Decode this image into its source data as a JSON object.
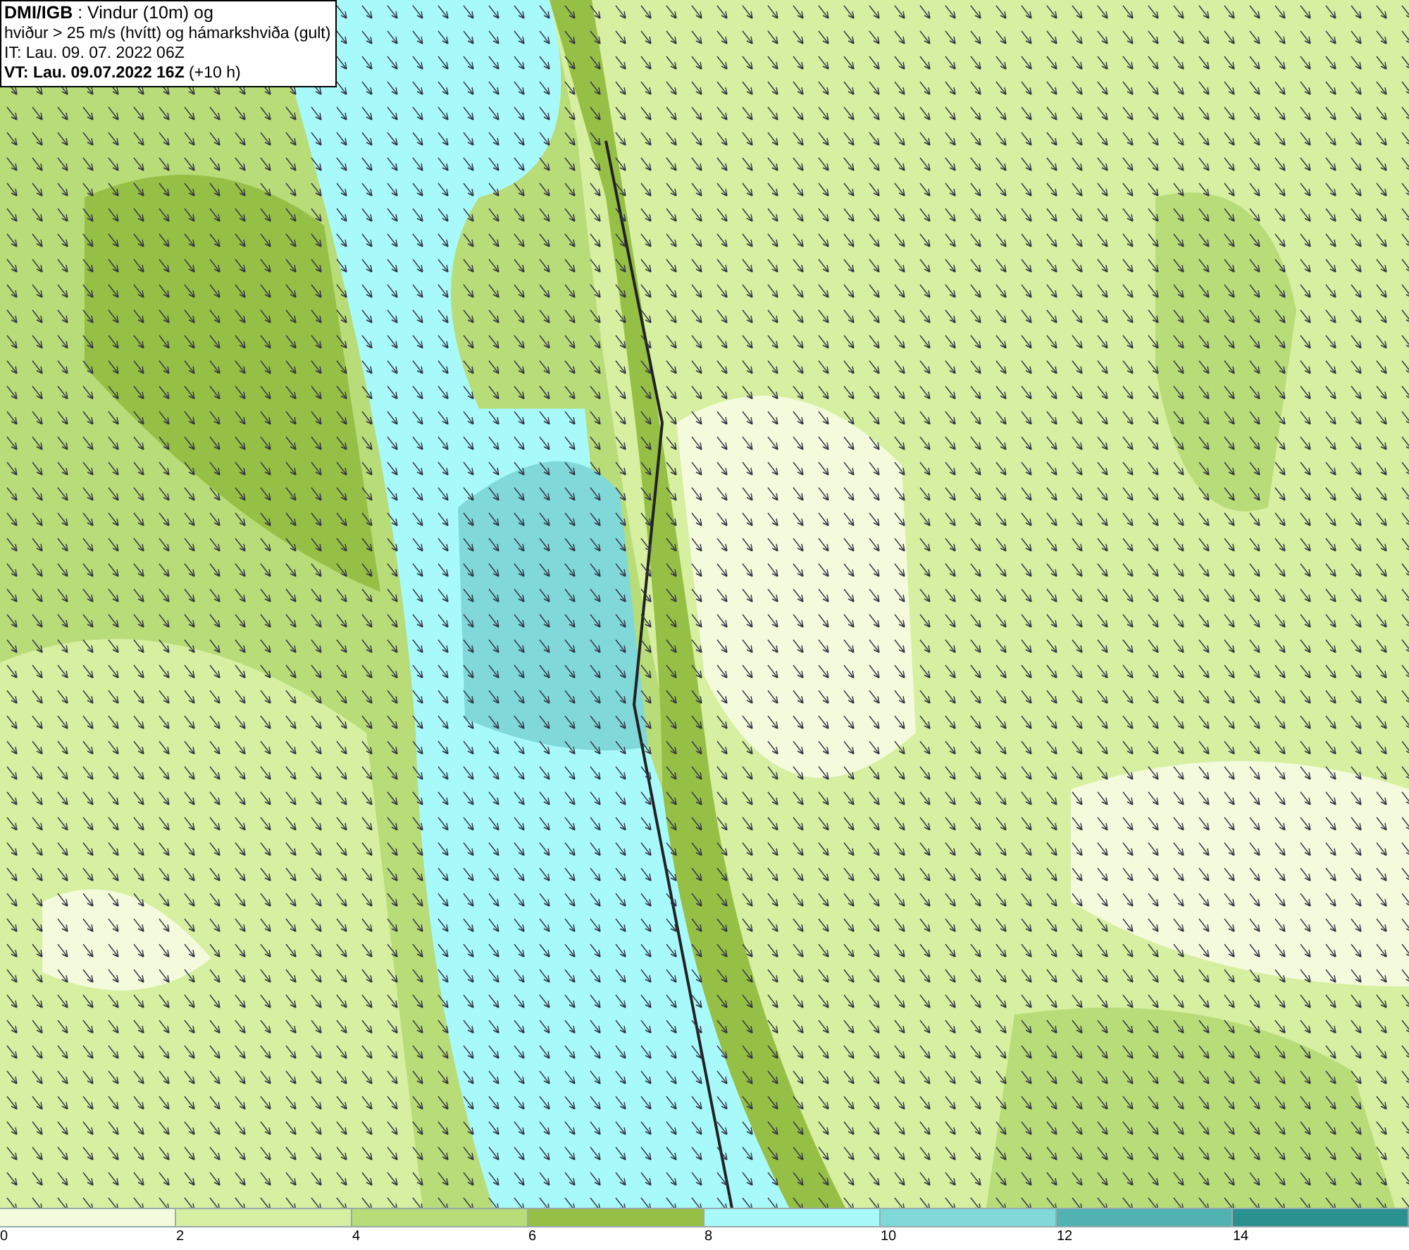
{
  "title_box": {
    "lines": [
      "**DMI/IGB** : Vindur (10m) og",
      "hviður > 25 m/s (hvítt) og hámarkshviða (gult)",
      "IT: Lau. 09. 07. 2022 06Z",
      "**VT: Lau. 09.07.2022 16Z** (+10 h)"
    ]
  },
  "legend": {
    "bins": [
      {
        "color": "#f4fbdc",
        "label": "0"
      },
      {
        "color": "#d6efa0",
        "label": "2"
      },
      {
        "color": "#b8dc78",
        "label": "4"
      },
      {
        "color": "#96bf46",
        "label": "6"
      },
      {
        "color": "#a8fafa",
        "label": "8"
      },
      {
        "color": "#80d8d8",
        "label": "10"
      },
      {
        "color": "#52b2b2",
        "label": "12"
      },
      {
        "color": "#2a9090",
        "label": "14"
      }
    ]
  }
}
